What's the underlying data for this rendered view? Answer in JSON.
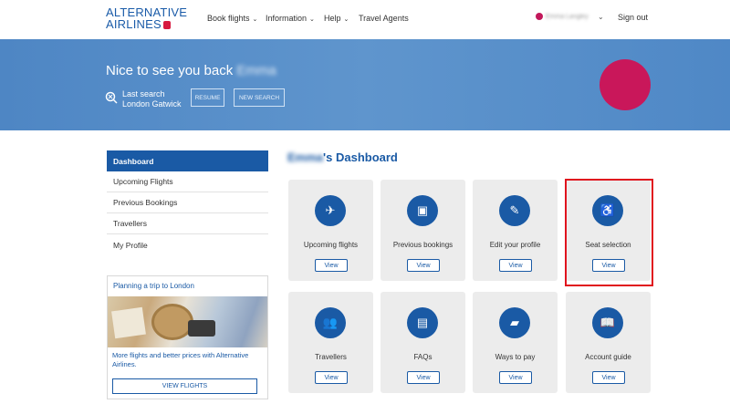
{
  "header": {
    "logo_line1": "ALTERNATIVE",
    "logo_line2": "AIRLINES",
    "nav": [
      {
        "label": "Book flights",
        "has_dropdown": true
      },
      {
        "label": "Information",
        "has_dropdown": true
      },
      {
        "label": "Help",
        "has_dropdown": true
      },
      {
        "label": "Travel Agents",
        "has_dropdown": false
      }
    ],
    "user_name": "Emma Langley",
    "sign_out": "Sign out"
  },
  "hero": {
    "greeting": "Nice to see you back",
    "greeting_name": "Emma",
    "last_search_label": "Last search",
    "last_search_value": "London Gatwick",
    "resume_label": "RESUME",
    "new_search_label": "NEW SEARCH",
    "avatar_color": "#c9175a"
  },
  "sidebar": {
    "items": [
      {
        "label": "Dashboard",
        "active": true
      },
      {
        "label": "Upcoming Flights",
        "active": false
      },
      {
        "label": "Previous Bookings",
        "active": false
      },
      {
        "label": "Travellers",
        "active": false
      },
      {
        "label": "My Profile",
        "active": false
      }
    ],
    "promo": {
      "title": "Planning a trip to London",
      "text": "More flights and better prices with Alternative Airlines.",
      "button": "VIEW FLIGHTS"
    }
  },
  "main": {
    "title_name": "Emma",
    "title_suffix": "'s Dashboard",
    "cards": [
      {
        "label": "Upcoming flights",
        "icon": "plane-icon",
        "glyph": "✈",
        "button": "View"
      },
      {
        "label": "Previous bookings",
        "icon": "screen-icon",
        "glyph": "▣",
        "button": "View"
      },
      {
        "label": "Edit your profile",
        "icon": "pencil-icon",
        "glyph": "✎",
        "button": "View"
      },
      {
        "label": "Seat selection",
        "icon": "seat-icon",
        "glyph": "♿",
        "button": "View",
        "highlighted": true
      },
      {
        "label": "Travellers",
        "icon": "people-icon",
        "glyph": "👥",
        "button": "View"
      },
      {
        "label": "FAQs",
        "icon": "document-icon",
        "glyph": "▤",
        "button": "View"
      },
      {
        "label": "Ways to pay",
        "icon": "wallet-icon",
        "glyph": "▰",
        "button": "View"
      },
      {
        "label": "Account guide",
        "icon": "book-icon",
        "glyph": "📖",
        "button": "View"
      }
    ]
  },
  "colors": {
    "brand_blue": "#1a5aa5",
    "hero_blue": "#5f95cd",
    "accent_red": "#d7193f",
    "highlight_red": "#e0141e"
  }
}
